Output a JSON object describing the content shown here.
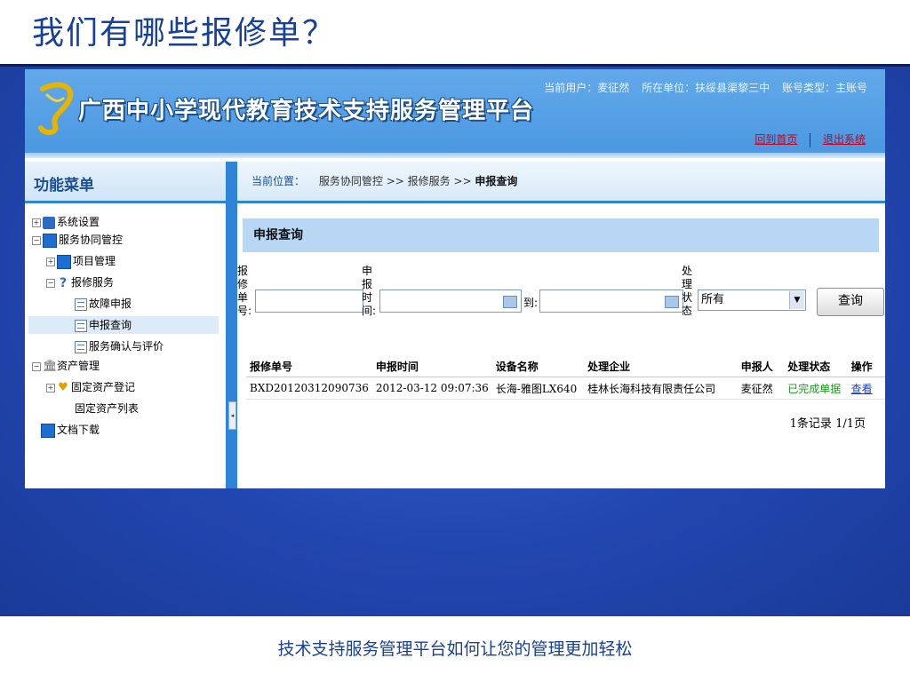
{
  "slide": {
    "title": "我们有哪些报修单？",
    "caption": "技术支持服务管理平台如何让您的管理更加轻松"
  },
  "header": {
    "logo_text": "广西中小学现代教育技术支持服务管理平台",
    "current_user": "当前用户：麦征然",
    "unit": "所在单位：扶绥县渠黎三中",
    "account_type": "账号类型：主账号",
    "home_link": "回到首页",
    "logout_link": "退出系统"
  },
  "sidebar": {
    "title": "功能菜单",
    "items": [
      {
        "label": "系统设置"
      },
      {
        "label": "服务协同管控"
      },
      {
        "label": "项目管理"
      },
      {
        "label": "报修服务"
      },
      {
        "label": "故障申报"
      },
      {
        "label": "申报查询"
      },
      {
        "label": "服务确认与评价"
      },
      {
        "label": "资产管理"
      },
      {
        "label": "固定资产登记"
      },
      {
        "label": "固定资产列表"
      },
      {
        "label": "文档下载"
      }
    ]
  },
  "breadcrumb": {
    "label": "当前位置：",
    "path1": "服务协同管控",
    "sep": ">>",
    "path2": "报修服务",
    "current": "申报查询"
  },
  "panel": {
    "title": "申报查询"
  },
  "search": {
    "order_no_label": "报修单号:",
    "order_no_value": "",
    "time_label": "申报时间:",
    "time_from": "",
    "to_label": "到:",
    "time_to": "",
    "status_label": "处理状态",
    "status_selected": "所有",
    "query_button": "查询"
  },
  "table": {
    "headers": [
      "报修单号",
      "申报时间",
      "设备名称",
      "处理企业",
      "申报人",
      "处理状态",
      "操作"
    ],
    "rows": [
      {
        "order_no": "BXD20120312090736",
        "time": "2012-03-12 09:07:36",
        "device": "长海-雅图LX640",
        "company": "桂林长海科技有限责任公司",
        "reporter": "麦征然",
        "status": "已完成单据",
        "action": "查看"
      }
    ]
  },
  "pager": {
    "records": "1条记录",
    "pages": "1/1页"
  }
}
